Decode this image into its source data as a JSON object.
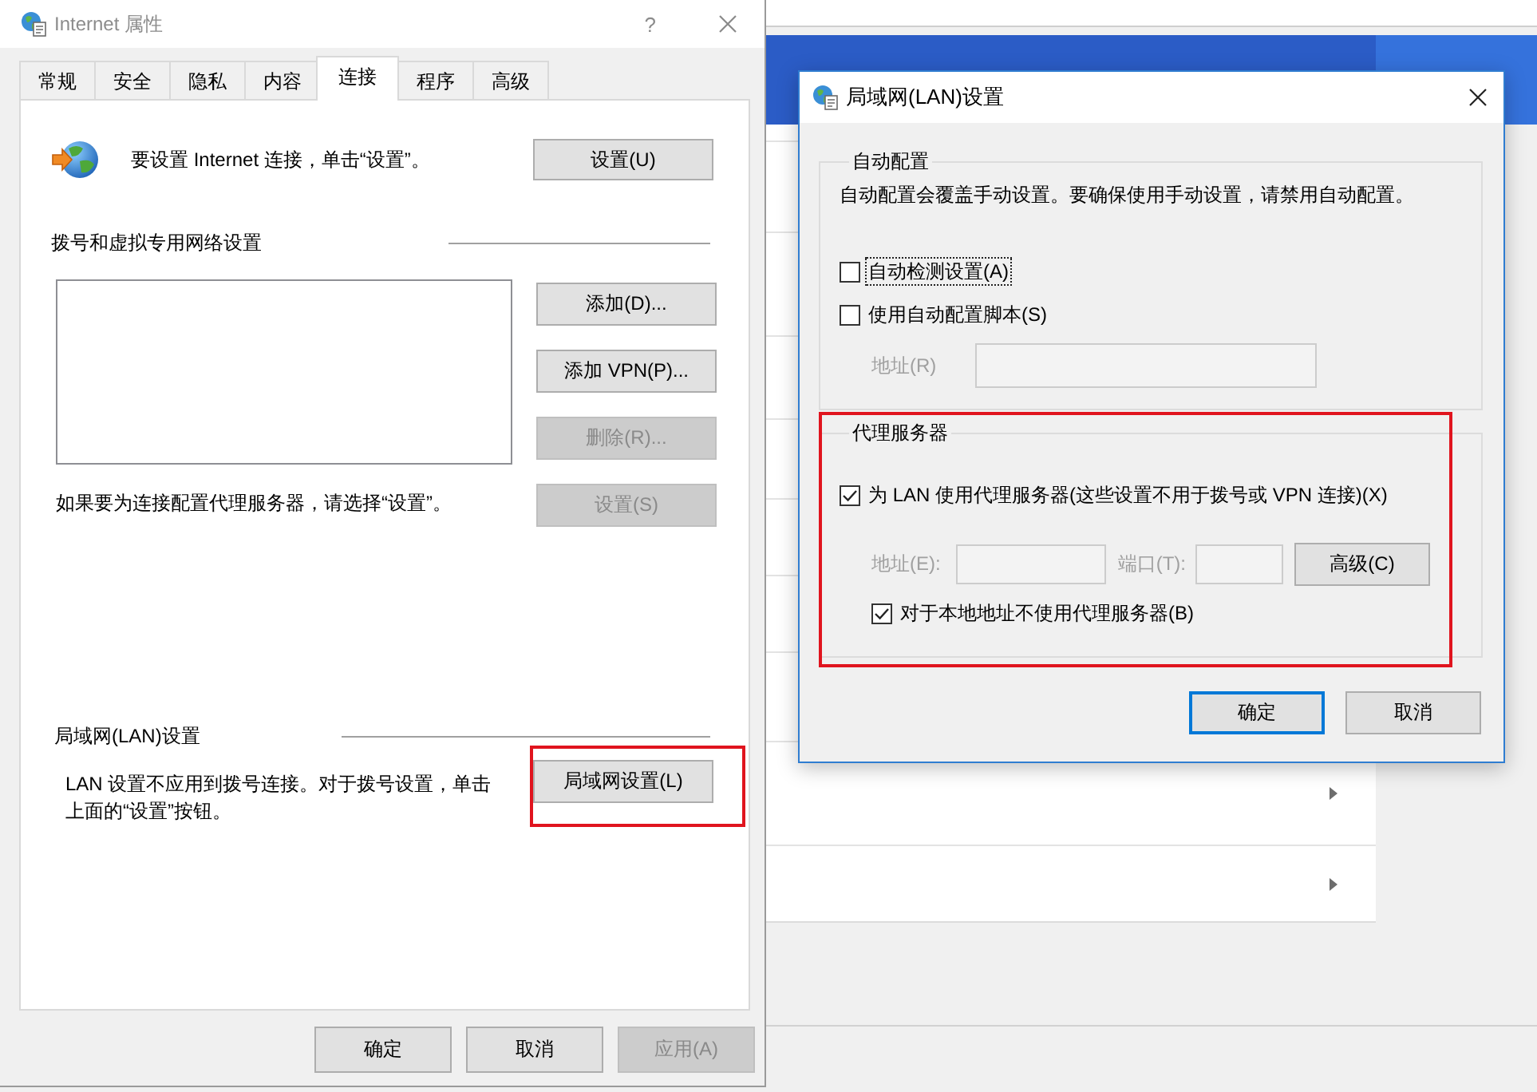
{
  "internet_properties": {
    "title": "Internet 属性",
    "help": "?",
    "tabs": [
      {
        "label": "常规",
        "selected": false
      },
      {
        "label": "安全",
        "selected": false
      },
      {
        "label": "隐私",
        "selected": false
      },
      {
        "label": "内容",
        "selected": false
      },
      {
        "label": "连接",
        "selected": true
      },
      {
        "label": "程序",
        "selected": false
      },
      {
        "label": "高级",
        "selected": false
      }
    ],
    "setup": {
      "text": "要设置 Internet 连接，单击“设置”。",
      "button": "设置(U)"
    },
    "dialup": {
      "heading": "拨号和虚拟专用网络设置",
      "buttons": [
        {
          "label": "添加(D)...",
          "disabled": false
        },
        {
          "label": "添加 VPN(P)...",
          "disabled": false
        },
        {
          "label": "删除(R)...",
          "disabled": true
        },
        {
          "label": "设置(S)",
          "disabled": true
        }
      ],
      "hint": "如果要为连接配置代理服务器，请选择“设置”。"
    },
    "lan": {
      "heading": "局域网(LAN)设置",
      "text": "LAN 设置不应用到拨号连接。对于拨号设置，单击上面的“设置”按钮。",
      "button": {
        "label": "局域网设置(L)",
        "highlighted": true
      }
    },
    "buttons": [
      {
        "label": "确定",
        "disabled": false
      },
      {
        "label": "取消",
        "disabled": false
      },
      {
        "label": "应用(A)",
        "disabled": true
      }
    ]
  },
  "lan_settings": {
    "title": "局域网(LAN)设置",
    "auto_config": {
      "heading": "自动配置",
      "text": "自动配置会覆盖手动设置。要确保使用手动设置，请禁用自动配置。",
      "options": [
        {
          "label": "自动检测设置(A)",
          "checked": false,
          "focused": true
        },
        {
          "label": "使用自动配置脚本(S)",
          "checked": false,
          "focused": false
        }
      ],
      "address": {
        "label": "地址(R)",
        "disabled": true
      }
    },
    "proxy": {
      "heading": "代理服务器",
      "highlighted": true,
      "use_proxy": {
        "label": "为 LAN 使用代理服务器(这些设置不用于拨号或 VPN 连接)(X)",
        "checked": true
      },
      "address": {
        "label": "地址(E):",
        "disabled": true
      },
      "port": {
        "label": "端口(T):",
        "disabled": true
      },
      "advanced": "高级(C)",
      "bypass_local": {
        "label": "对于本地地址不使用代理服务器(B)",
        "checked": true
      }
    },
    "buttons": [
      {
        "label": "确定",
        "default": true
      },
      {
        "label": "取消",
        "default": false
      }
    ]
  }
}
